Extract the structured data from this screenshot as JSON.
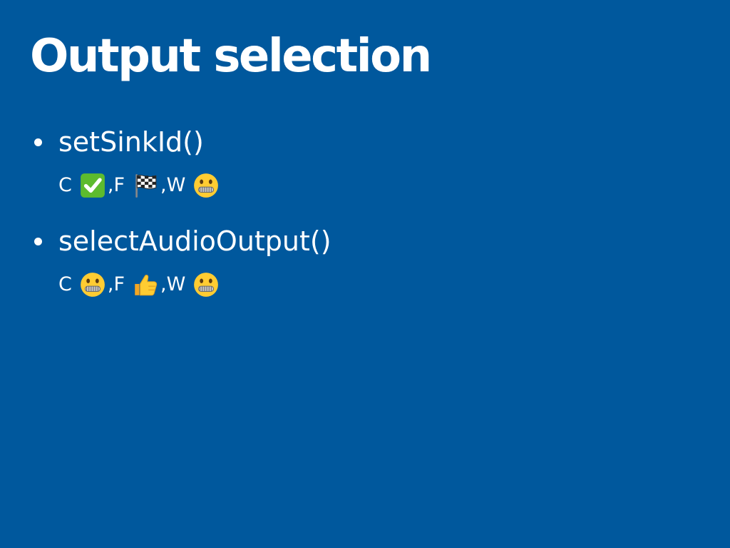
{
  "slide": {
    "title": "Output selection",
    "items": [
      {
        "label": "setSinkId()",
        "support": [
          {
            "browser": "C",
            "status_icon": "check-mark-icon",
            "sep": ", "
          },
          {
            "browser": "F",
            "status_icon": "checkered-flag-icon",
            "sep": ", "
          },
          {
            "browser": "W",
            "status_icon": "zipper-mouth-face-icon",
            "sep": ""
          }
        ]
      },
      {
        "label": "selectAudioOutput()",
        "support": [
          {
            "browser": "C",
            "status_icon": "zipper-mouth-face-icon",
            "sep": ", "
          },
          {
            "browser": "F",
            "status_icon": "thumbs-up-icon",
            "sep": ", "
          },
          {
            "browser": "W",
            "status_icon": "zipper-mouth-face-icon",
            "sep": ""
          }
        ]
      }
    ]
  },
  "colors": {
    "background": "#00589d",
    "text": "#ffffff",
    "check_green": "#5dbb2e",
    "emoji_yellow": "#ffcc32"
  }
}
